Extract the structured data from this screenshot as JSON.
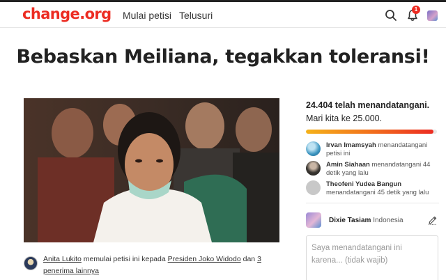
{
  "header": {
    "logo": "change.org",
    "nav": [
      "Mulai petisi",
      "Telusuri"
    ],
    "notification_count": "1",
    "brand_color": "#ec2c22"
  },
  "petition": {
    "title": "Bebaskan Meiliana, tegakkan toleransi!",
    "photo": "petition-photo",
    "starter_name": "Anita Lukito",
    "starter_mid": "memulai petisi ini kepada",
    "recipient": "Presiden Joko Widodo",
    "and": "dan",
    "others": "3 penerima lainnya"
  },
  "sidebar": {
    "signed_count": "24.404 telah menandatangani.",
    "goal": "Mari kita ke 25.000.",
    "progress_fraction": 0.976,
    "recent_signers": [
      {
        "name": "Irvan Imamsyah",
        "action": "menandatangani petisi ini"
      },
      {
        "name": "Amin Siahaan",
        "action": "menandatangani 44 detik yang lalu"
      },
      {
        "name": "Theofeni Yudea Bangun",
        "action": "menandatangani 45 detik yang lalu"
      }
    ],
    "current_user": {
      "name": "Dixie Tasiam",
      "country": "Indonesia"
    },
    "comment_placeholder": "Saya menandatangani ini karena... (tidak wajib)"
  },
  "icons": [
    "search-icon",
    "bell-icon",
    "edit-icon"
  ]
}
